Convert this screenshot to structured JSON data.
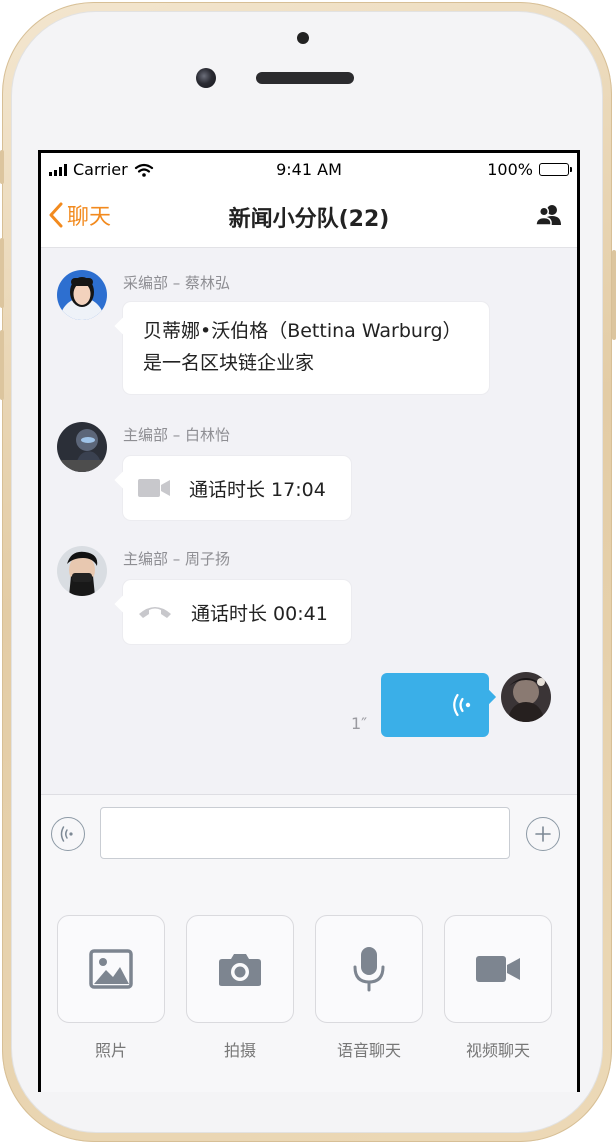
{
  "status_bar": {
    "carrier": "Carrier",
    "time": "9:41 AM",
    "battery": "100%"
  },
  "nav": {
    "back_label": "聊天",
    "title": "新闻小分队(22)"
  },
  "messages": [
    {
      "sender": "采编部 – 蔡林弘",
      "text": "贝蒂娜•沃伯格（Bettina Warburg）是一名区块链企业家"
    },
    {
      "sender": "主编部 – 白林怡",
      "text": "通话时长 17:04"
    },
    {
      "sender": "主编部 – 周子扬",
      "text": "通话时长 00:41"
    },
    {
      "duration": "1″"
    }
  ],
  "input": {
    "value": "",
    "placeholder": ""
  },
  "tools": [
    {
      "label": "照片",
      "icon": "photo-icon"
    },
    {
      "label": "拍摄",
      "icon": "camera-icon"
    },
    {
      "label": "语音聊天",
      "icon": "microphone-icon"
    },
    {
      "label": "视频聊天",
      "icon": "video-camera-icon"
    }
  ],
  "colors": {
    "accent": "#f28a1e",
    "voice_bubble": "#3aafe8",
    "icon_gray": "#7d8590"
  }
}
